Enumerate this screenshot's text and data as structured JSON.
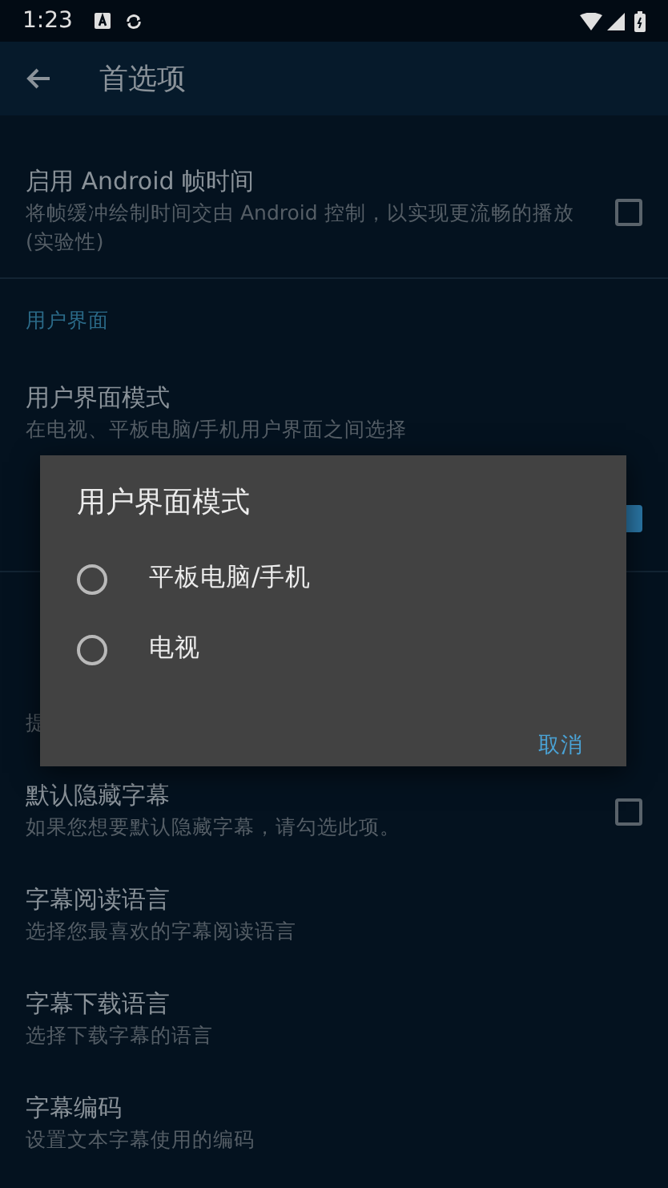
{
  "status_bar": {
    "time": "1:23"
  },
  "app_bar": {
    "title": "首选项"
  },
  "preferences": [
    {
      "kind": "item",
      "title": "启用 Android 帧时间",
      "subtitle": "将帧缓冲绘制时间交由 Android 控制，以实现更流畅的播放 (实验性)",
      "checked": false
    },
    {
      "kind": "divider"
    },
    {
      "kind": "header",
      "title": "用户界面"
    },
    {
      "kind": "item",
      "title": "用户界面模式",
      "subtitle": "在电视、平板电脑/手机用户界面之间选择"
    },
    {
      "kind": "item",
      "checked": true
    },
    {
      "kind": "divider"
    },
    {
      "kind": "header"
    },
    {
      "kind": "item",
      "subtitle": "提"
    },
    {
      "kind": "item",
      "title": "默认隐藏字幕",
      "subtitle": "如果您想要默认隐藏字幕，请勾选此项。",
      "checked": false
    },
    {
      "kind": "item",
      "title": "字幕阅读语言",
      "subtitle": "选择您最喜欢的字幕阅读语言"
    },
    {
      "kind": "item",
      "title": "字幕下载语言",
      "subtitle": "选择下载字幕的语言"
    },
    {
      "kind": "item",
      "title": "字幕编码",
      "subtitle": "设置文本字幕使用的编码"
    }
  ],
  "dialog": {
    "title": "用户界面模式",
    "options": [
      {
        "label": "平板电脑/手机",
        "selected": false
      },
      {
        "label": "电视",
        "selected": false
      }
    ],
    "buttons": [
      "取消"
    ]
  }
}
